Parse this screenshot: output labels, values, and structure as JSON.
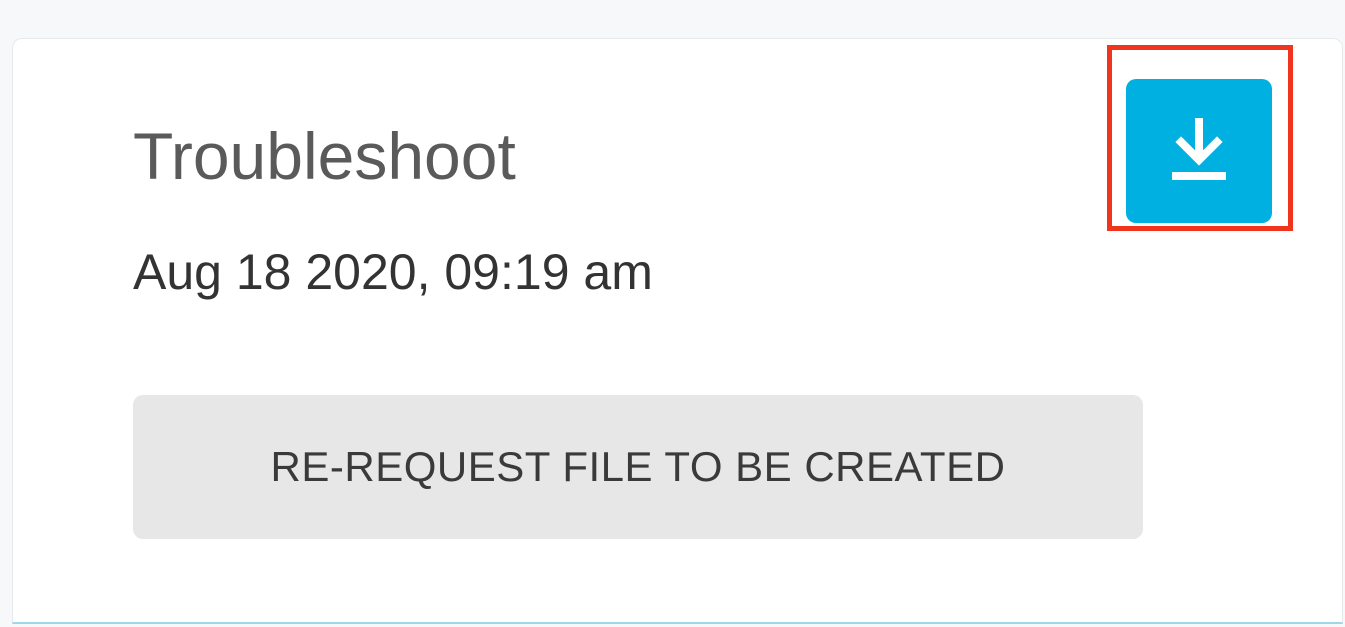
{
  "card": {
    "title": "Troubleshoot",
    "timestamp": "Aug 18 2020, 09:19 am",
    "rerequest_label": "RE-REQUEST FILE TO BE CREATED",
    "download_icon": "download-icon"
  },
  "colors": {
    "accent": "#00b0e0",
    "highlight": "#f0341e",
    "secondary_button": "#e7e7e7"
  }
}
